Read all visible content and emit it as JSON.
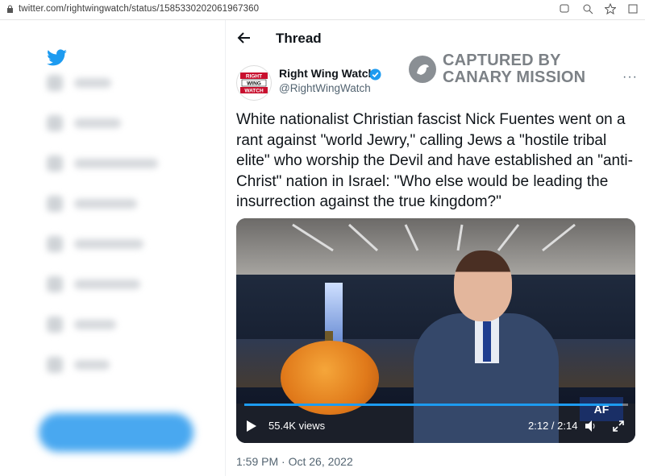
{
  "browser": {
    "url": "twitter.com/rightwingwatch/status/1585330202061967360"
  },
  "header": {
    "title": "Thread"
  },
  "tweet": {
    "author_name": "Right Wing Watch",
    "author_handle": "@RightWingWatch",
    "avatar_lines": [
      "RIGHT",
      "WING",
      "WATCH"
    ],
    "text": "White nationalist Christian fascist Nick Fuentes went on a rant against \"world Jewry,\" calling Jews a \"hostile tribal elite\" who worship the Devil and have established an \"anti-Christ\" nation in Israel: \"Who else would be leading the insurrection against the true kingdom?\"",
    "timestamp": "1:59 PM · Oct 26, 2022",
    "more_label": "···"
  },
  "watermark": {
    "line1": "CAPTURED BY",
    "line2": "CANARY MISSION"
  },
  "video": {
    "views": "55.4K views",
    "time": "2:12 / 2:14",
    "progress": 0.985,
    "logo_text": "AF"
  },
  "colors": {
    "accent": "#1d9bf0",
    "text": "#0f1419",
    "muted": "#536471"
  }
}
